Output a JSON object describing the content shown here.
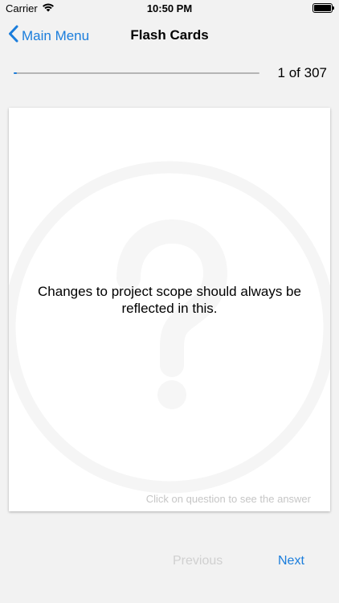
{
  "status_bar": {
    "carrier": "Carrier",
    "time": "10:50 PM"
  },
  "nav": {
    "back_label": "Main Menu",
    "title": "Flash Cards"
  },
  "progress": {
    "current": 1,
    "total": 307,
    "label": "1 of 307",
    "fraction": 0.003
  },
  "card": {
    "question": "Changes to project scope should always be reflected in this.",
    "hint": "Click on question to see the answer",
    "watermark_icon": "question-mark-circle-icon"
  },
  "footer": {
    "previous_label": "Previous",
    "next_label": "Next"
  },
  "colors": {
    "accent": "#1a7ddc",
    "disabled": "#d0d0d0",
    "background": "#f2f2f2"
  }
}
